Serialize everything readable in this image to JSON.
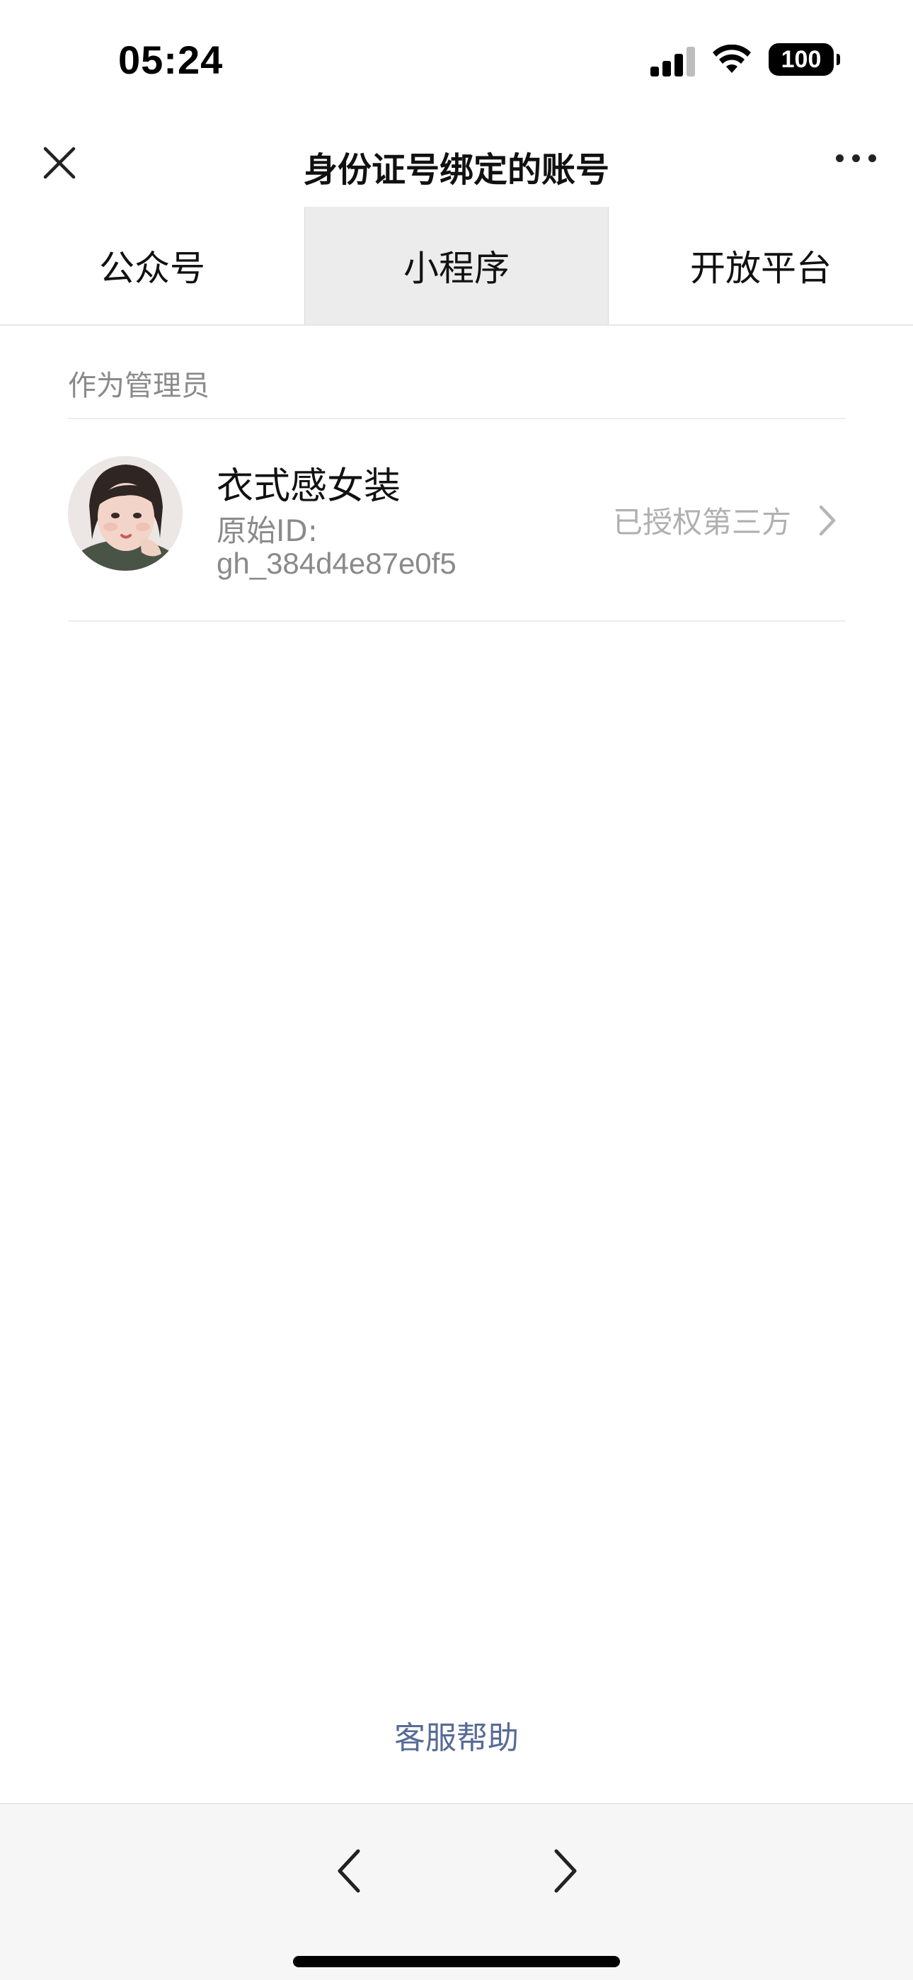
{
  "status_bar": {
    "time": "05:24",
    "battery": "100",
    "icons": [
      "signal-icon",
      "wifi-icon",
      "battery-icon"
    ]
  },
  "nav": {
    "title": "身份证号绑定的账号",
    "close_icon": "close-icon",
    "more_icon": "more-icon"
  },
  "tabs": [
    {
      "label": "公众号",
      "active": false
    },
    {
      "label": "小程序",
      "active": true
    },
    {
      "label": "开放平台",
      "active": false
    }
  ],
  "section": {
    "header": "作为管理员",
    "accounts": [
      {
        "name": "衣式感女装",
        "id_label": "原始ID:",
        "id_value": "gh_384d4e87e0f5",
        "status": "已授权第三方",
        "avatar": "avatar-photo"
      }
    ]
  },
  "footer": {
    "help_label": "客服帮助",
    "back_icon": "chevron-left-icon",
    "forward_icon": "chevron-right-icon"
  },
  "colors": {
    "link": "#576b95",
    "active_tab_bg": "#ececec",
    "toolbar_bg": "#f6f6f6",
    "muted_text": "#8a8a8a"
  }
}
